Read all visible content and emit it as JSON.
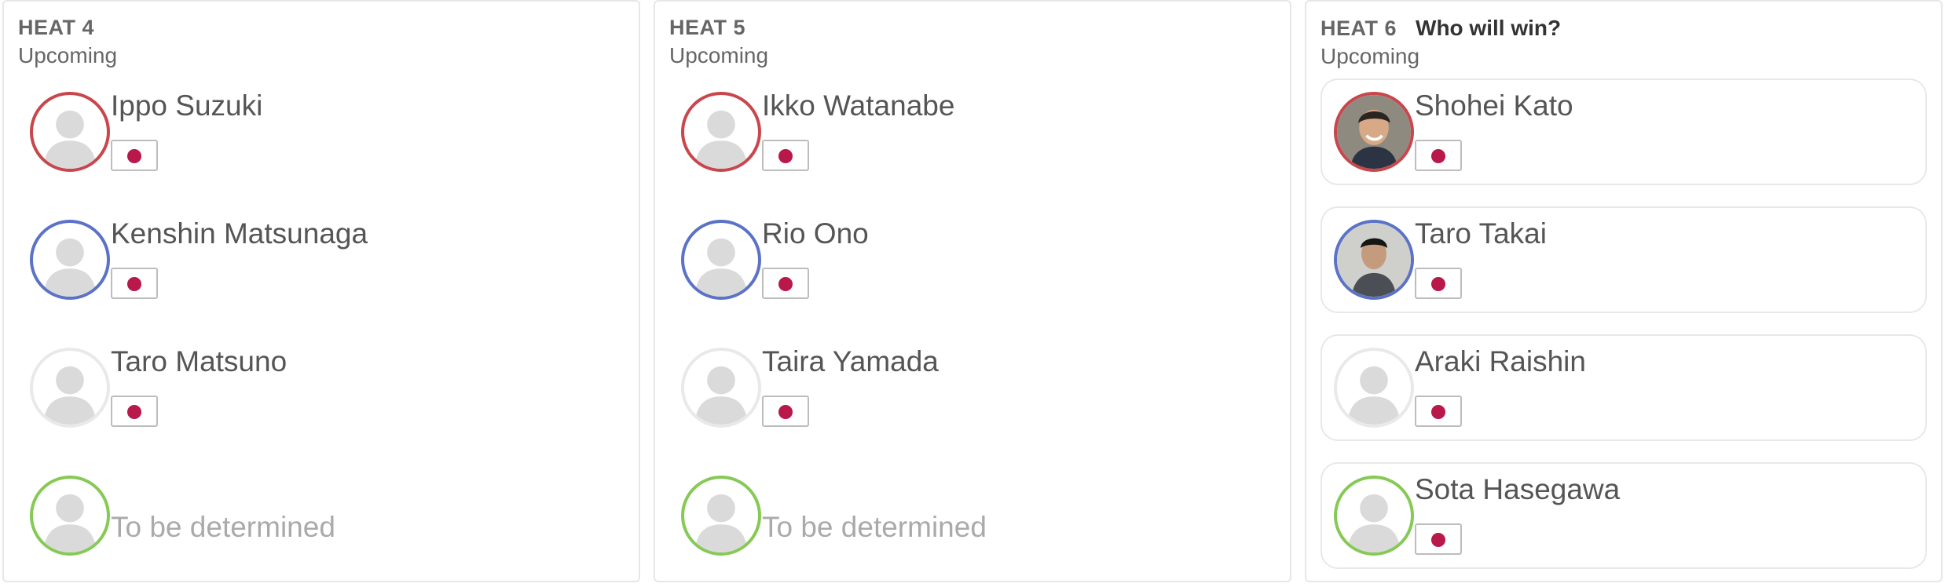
{
  "heats": [
    {
      "label": "HEAT 4",
      "status": "Upcoming",
      "prompt": "",
      "athletes": [
        {
          "name": "Ippo Suzuki",
          "color": "red",
          "flag": "japan-flag"
        },
        {
          "name": "Kenshin Matsunaga",
          "color": "blue",
          "flag": "japan-flag"
        },
        {
          "name": "Taro Matsuno",
          "color": "grey",
          "flag": "japan-flag"
        },
        {
          "name": "To be determined",
          "color": "green",
          "flag": ""
        }
      ]
    },
    {
      "label": "HEAT 5",
      "status": "Upcoming",
      "prompt": "",
      "athletes": [
        {
          "name": "Ikko Watanabe",
          "color": "red",
          "flag": "japan-flag"
        },
        {
          "name": "Rio Ono",
          "color": "blue",
          "flag": "japan-flag"
        },
        {
          "name": "Taira Yamada",
          "color": "grey",
          "flag": "japan-flag"
        },
        {
          "name": "To be determined",
          "color": "green",
          "flag": ""
        }
      ]
    },
    {
      "label": "HEAT 6",
      "status": "Upcoming",
      "prompt": "Who will win?",
      "athletes": [
        {
          "name": "Shohei Kato",
          "color": "red",
          "flag": "japan-flag",
          "photo": true
        },
        {
          "name": "Taro Takai",
          "color": "blue",
          "flag": "japan-flag",
          "photo": true
        },
        {
          "name": "Araki Raishin",
          "color": "grey",
          "flag": "japan-flag"
        },
        {
          "name": "Sota Hasegawa",
          "color": "green",
          "flag": "japan-flag"
        }
      ]
    }
  ],
  "colors": {
    "red": "#c8464c",
    "blue": "#5b72c6",
    "grey": "#e9e9e9",
    "green": "#86c955",
    "flag_sun": "#b8184a"
  },
  "icons": {
    "avatar": "user-silhouette-icon",
    "flag": "japan-flag"
  }
}
